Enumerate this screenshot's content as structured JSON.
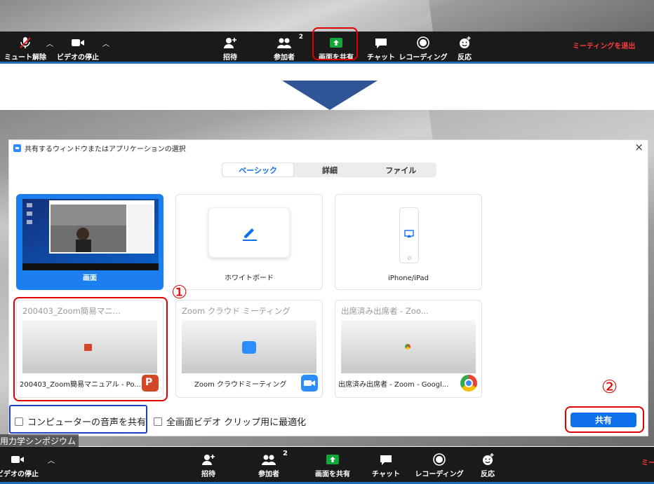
{
  "top_toolbar": {
    "mute_label": "ミュート解除",
    "video_label": "ビデオの停止",
    "invite_label": "招待",
    "participants_label": "参加者",
    "participants_count": "2",
    "share_label": "画面を共有",
    "chat_label": "チャット",
    "record_label": "レコーディング",
    "reactions_label": "反応",
    "leave_label": "ミーティングを退出"
  },
  "dialog": {
    "title": "共有するウィンドウまたはアプリケーションの選択",
    "tabs": [
      {
        "label": "ベーシック"
      },
      {
        "label": "詳細"
      },
      {
        "label": "ファイル"
      }
    ],
    "cards": [
      {
        "label": "画面"
      },
      {
        "label": "ホワイトボード"
      },
      {
        "label": "iPhone/iPad"
      }
    ],
    "windows": [
      {
        "title": "200403_Zoom簡易マニ...",
        "label": "200403_Zoom簡易マニュアル - Po..."
      },
      {
        "title": "Zoom クラウド ミーティング",
        "label": "Zoom クラウドミーティング"
      },
      {
        "title": "出席済み出席者 - Zoo...",
        "label": "出席済み出席者 - Zoom - Googl..."
      }
    ],
    "checkbox_audio": "コンピューターの音声を共有",
    "checkbox_video": "全画面ビデオ クリップ用に最適化",
    "share_button": "共有",
    "marker_1": "①",
    "marker_2": "②"
  },
  "background_title": "用力学シンポジウム",
  "bottom_toolbar": {
    "video_label": "ビデオの停止",
    "invite_label": "招待",
    "participants_label": "参加者",
    "participants_count": "2",
    "share_label": "画面を共有",
    "chat_label": "チャット",
    "record_label": "レコーディング",
    "reactions_label": "反応",
    "leave_label": "ミー"
  },
  "colors": {
    "accent": "#0e71eb",
    "highlight_red": "#e00000",
    "highlight_blue": "#1f3fbf",
    "share_green": "#13a538"
  }
}
